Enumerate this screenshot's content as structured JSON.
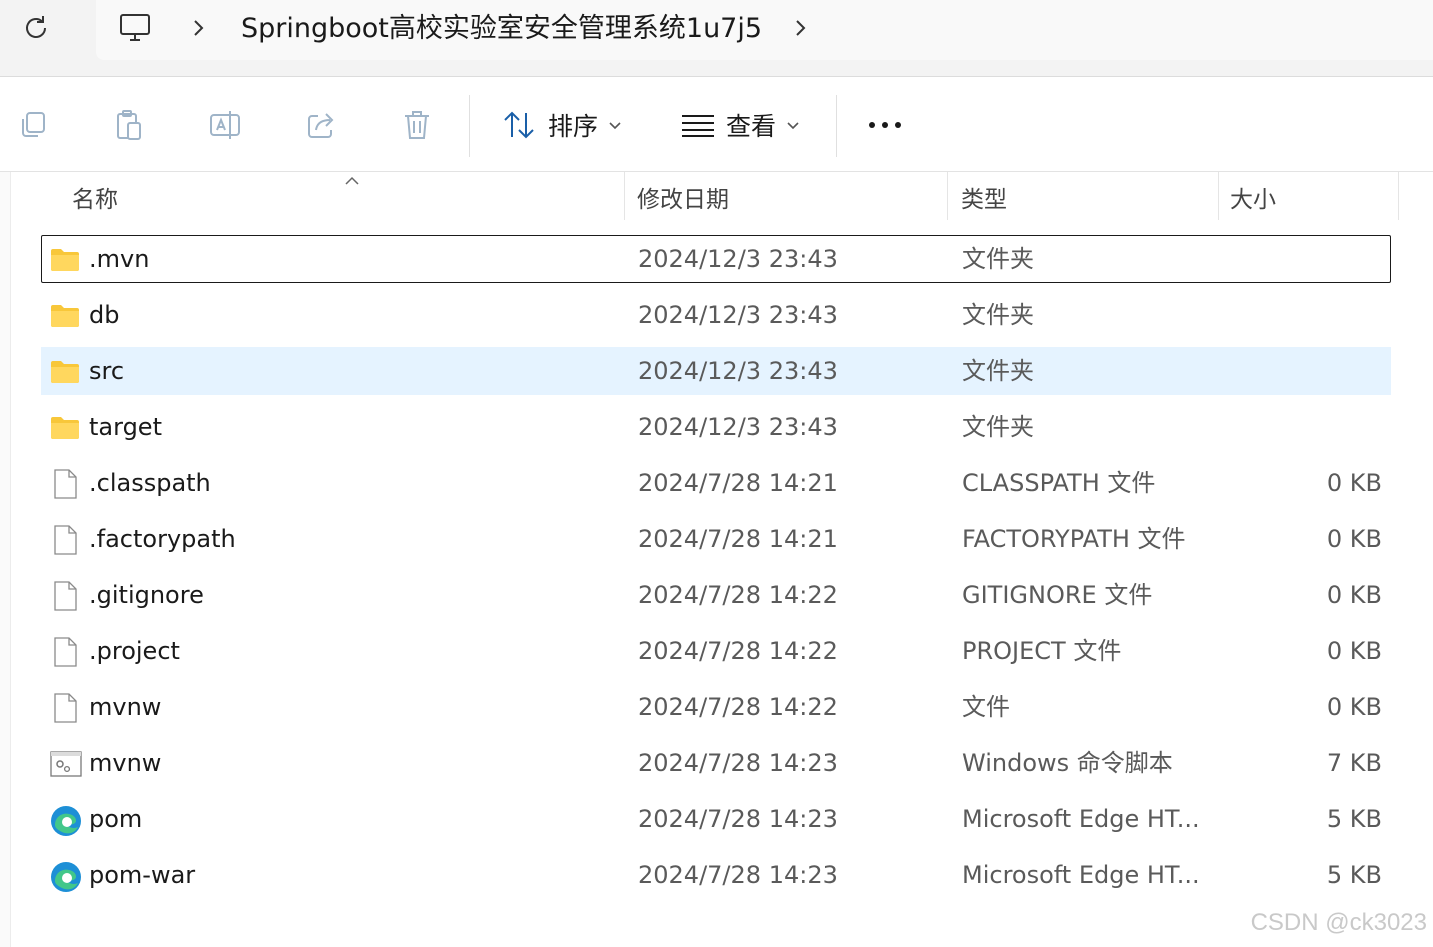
{
  "address": {
    "breadcrumb": "Springboot高校实验室安全管理系统1u7j5",
    "icons": [
      "refresh-icon",
      "computer-icon",
      "chevron-right-icon"
    ]
  },
  "toolbar": {
    "sort_label": "排序",
    "view_label": "查看",
    "icons": [
      "copy-icon",
      "paste-icon",
      "rename-icon",
      "share-icon",
      "delete-icon",
      "sort-icon",
      "view-icon",
      "more-icon"
    ]
  },
  "columns": {
    "name": "名称",
    "date": "修改日期",
    "type": "类型",
    "size": "大小"
  },
  "files": [
    {
      "name": ".mvn",
      "date": "2024/12/3 23:43",
      "type": "文件夹",
      "size": "",
      "icon": "folder-icon"
    },
    {
      "name": "db",
      "date": "2024/12/3 23:43",
      "type": "文件夹",
      "size": "",
      "icon": "folder-icon"
    },
    {
      "name": "src",
      "date": "2024/12/3 23:43",
      "type": "文件夹",
      "size": "",
      "icon": "folder-icon"
    },
    {
      "name": "target",
      "date": "2024/12/3 23:43",
      "type": "文件夹",
      "size": "",
      "icon": "folder-icon"
    },
    {
      "name": ".classpath",
      "date": "2024/7/28 14:21",
      "type": "CLASSPATH 文件",
      "size": "0 KB",
      "icon": "file-icon"
    },
    {
      "name": ".factorypath",
      "date": "2024/7/28 14:21",
      "type": "FACTORYPATH 文件",
      "size": "0 KB",
      "icon": "file-icon"
    },
    {
      "name": ".gitignore",
      "date": "2024/7/28 14:22",
      "type": "GITIGNORE 文件",
      "size": "0 KB",
      "icon": "file-icon"
    },
    {
      "name": ".project",
      "date": "2024/7/28 14:22",
      "type": "PROJECT 文件",
      "size": "0 KB",
      "icon": "file-icon"
    },
    {
      "name": "mvnw",
      "date": "2024/7/28 14:22",
      "type": "文件",
      "size": "0 KB",
      "icon": "file-icon"
    },
    {
      "name": "mvnw",
      "date": "2024/7/28 14:23",
      "type": "Windows 命令脚本",
      "size": "7 KB",
      "icon": "script-icon"
    },
    {
      "name": "pom",
      "date": "2024/7/28 14:23",
      "type": "Microsoft Edge HT...",
      "size": "5 KB",
      "icon": "edge-icon"
    },
    {
      "name": "pom-war",
      "date": "2024/7/28 14:23",
      "type": "Microsoft Edge HT...",
      "size": "5 KB",
      "icon": "edge-icon"
    }
  ],
  "selection": {
    "focused_index": 0,
    "selected_index": 2
  },
  "watermark": "CSDN @ck3023",
  "colors": {
    "folder": "#f8c73a",
    "selected": "#e5f3ff",
    "edge": "#1d8fd6"
  }
}
